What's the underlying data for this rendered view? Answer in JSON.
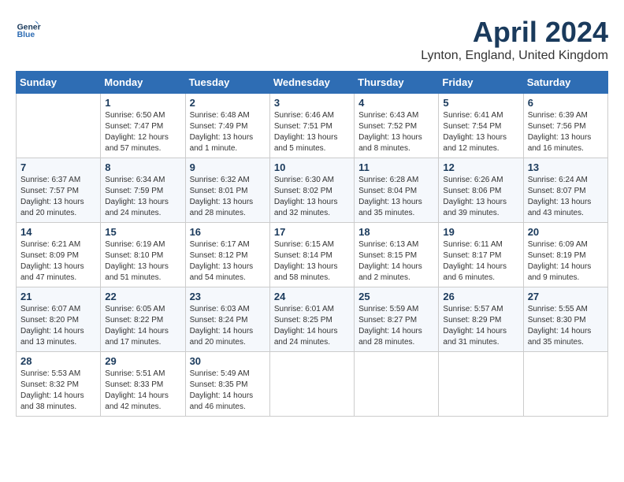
{
  "header": {
    "logo_line1": "General",
    "logo_line2": "Blue",
    "month": "April 2024",
    "location": "Lynton, England, United Kingdom"
  },
  "weekdays": [
    "Sunday",
    "Monday",
    "Tuesday",
    "Wednesday",
    "Thursday",
    "Friday",
    "Saturday"
  ],
  "weeks": [
    [
      {
        "day": "",
        "info": ""
      },
      {
        "day": "1",
        "info": "Sunrise: 6:50 AM\nSunset: 7:47 PM\nDaylight: 12 hours\nand 57 minutes."
      },
      {
        "day": "2",
        "info": "Sunrise: 6:48 AM\nSunset: 7:49 PM\nDaylight: 13 hours\nand 1 minute."
      },
      {
        "day": "3",
        "info": "Sunrise: 6:46 AM\nSunset: 7:51 PM\nDaylight: 13 hours\nand 5 minutes."
      },
      {
        "day": "4",
        "info": "Sunrise: 6:43 AM\nSunset: 7:52 PM\nDaylight: 13 hours\nand 8 minutes."
      },
      {
        "day": "5",
        "info": "Sunrise: 6:41 AM\nSunset: 7:54 PM\nDaylight: 13 hours\nand 12 minutes."
      },
      {
        "day": "6",
        "info": "Sunrise: 6:39 AM\nSunset: 7:56 PM\nDaylight: 13 hours\nand 16 minutes."
      }
    ],
    [
      {
        "day": "7",
        "info": "Sunrise: 6:37 AM\nSunset: 7:57 PM\nDaylight: 13 hours\nand 20 minutes."
      },
      {
        "day": "8",
        "info": "Sunrise: 6:34 AM\nSunset: 7:59 PM\nDaylight: 13 hours\nand 24 minutes."
      },
      {
        "day": "9",
        "info": "Sunrise: 6:32 AM\nSunset: 8:01 PM\nDaylight: 13 hours\nand 28 minutes."
      },
      {
        "day": "10",
        "info": "Sunrise: 6:30 AM\nSunset: 8:02 PM\nDaylight: 13 hours\nand 32 minutes."
      },
      {
        "day": "11",
        "info": "Sunrise: 6:28 AM\nSunset: 8:04 PM\nDaylight: 13 hours\nand 35 minutes."
      },
      {
        "day": "12",
        "info": "Sunrise: 6:26 AM\nSunset: 8:06 PM\nDaylight: 13 hours\nand 39 minutes."
      },
      {
        "day": "13",
        "info": "Sunrise: 6:24 AM\nSunset: 8:07 PM\nDaylight: 13 hours\nand 43 minutes."
      }
    ],
    [
      {
        "day": "14",
        "info": "Sunrise: 6:21 AM\nSunset: 8:09 PM\nDaylight: 13 hours\nand 47 minutes."
      },
      {
        "day": "15",
        "info": "Sunrise: 6:19 AM\nSunset: 8:10 PM\nDaylight: 13 hours\nand 51 minutes."
      },
      {
        "day": "16",
        "info": "Sunrise: 6:17 AM\nSunset: 8:12 PM\nDaylight: 13 hours\nand 54 minutes."
      },
      {
        "day": "17",
        "info": "Sunrise: 6:15 AM\nSunset: 8:14 PM\nDaylight: 13 hours\nand 58 minutes."
      },
      {
        "day": "18",
        "info": "Sunrise: 6:13 AM\nSunset: 8:15 PM\nDaylight: 14 hours\nand 2 minutes."
      },
      {
        "day": "19",
        "info": "Sunrise: 6:11 AM\nSunset: 8:17 PM\nDaylight: 14 hours\nand 6 minutes."
      },
      {
        "day": "20",
        "info": "Sunrise: 6:09 AM\nSunset: 8:19 PM\nDaylight: 14 hours\nand 9 minutes."
      }
    ],
    [
      {
        "day": "21",
        "info": "Sunrise: 6:07 AM\nSunset: 8:20 PM\nDaylight: 14 hours\nand 13 minutes."
      },
      {
        "day": "22",
        "info": "Sunrise: 6:05 AM\nSunset: 8:22 PM\nDaylight: 14 hours\nand 17 minutes."
      },
      {
        "day": "23",
        "info": "Sunrise: 6:03 AM\nSunset: 8:24 PM\nDaylight: 14 hours\nand 20 minutes."
      },
      {
        "day": "24",
        "info": "Sunrise: 6:01 AM\nSunset: 8:25 PM\nDaylight: 14 hours\nand 24 minutes."
      },
      {
        "day": "25",
        "info": "Sunrise: 5:59 AM\nSunset: 8:27 PM\nDaylight: 14 hours\nand 28 minutes."
      },
      {
        "day": "26",
        "info": "Sunrise: 5:57 AM\nSunset: 8:29 PM\nDaylight: 14 hours\nand 31 minutes."
      },
      {
        "day": "27",
        "info": "Sunrise: 5:55 AM\nSunset: 8:30 PM\nDaylight: 14 hours\nand 35 minutes."
      }
    ],
    [
      {
        "day": "28",
        "info": "Sunrise: 5:53 AM\nSunset: 8:32 PM\nDaylight: 14 hours\nand 38 minutes."
      },
      {
        "day": "29",
        "info": "Sunrise: 5:51 AM\nSunset: 8:33 PM\nDaylight: 14 hours\nand 42 minutes."
      },
      {
        "day": "30",
        "info": "Sunrise: 5:49 AM\nSunset: 8:35 PM\nDaylight: 14 hours\nand 46 minutes."
      },
      {
        "day": "",
        "info": ""
      },
      {
        "day": "",
        "info": ""
      },
      {
        "day": "",
        "info": ""
      },
      {
        "day": "",
        "info": ""
      }
    ]
  ]
}
